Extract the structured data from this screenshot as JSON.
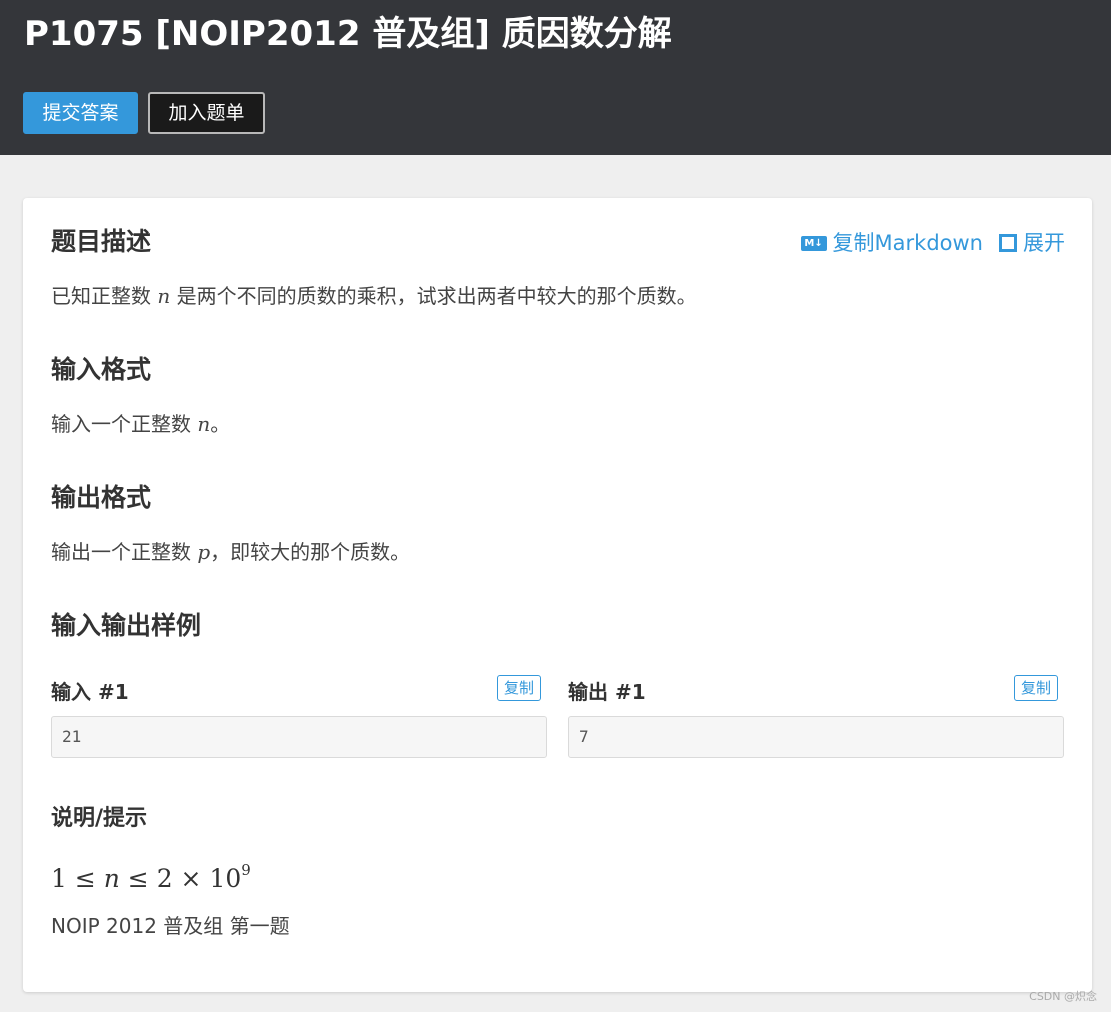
{
  "header": {
    "title": "P1075 [NOIP2012 普及组] 质因数分解",
    "submit_label": "提交答案",
    "add_label": "加入题单"
  },
  "actions": {
    "copy_md_icon": "M↓",
    "copy_md_label": "复制Markdown",
    "expand_label": "展开"
  },
  "description": {
    "heading": "题目描述",
    "text_before": "已知正整数 ",
    "var": "n",
    "text_after": " 是两个不同的质数的乘积，试求出两者中较大的那个质数。"
  },
  "input_format": {
    "heading": "输入格式",
    "text_before": "输入一个正整数 ",
    "var": "n",
    "text_after": "。"
  },
  "output_format": {
    "heading": "输出格式",
    "text_before": "输出一个正整数 ",
    "var": "p",
    "text_after": "，即较大的那个质数。"
  },
  "samples": {
    "heading": "输入输出样例",
    "input_label": "输入 #1",
    "output_label": "输出 #1",
    "copy_label": "复制",
    "input_value": "21",
    "output_value": "7"
  },
  "hint": {
    "heading": "说明/提示",
    "formula_a": "1 ≤ ",
    "formula_var": "n",
    "formula_b": " ≤ 2 × 10",
    "formula_exp": "9",
    "source": "NOIP 2012 普及组 第一题"
  },
  "watermark": "CSDN @炽念"
}
